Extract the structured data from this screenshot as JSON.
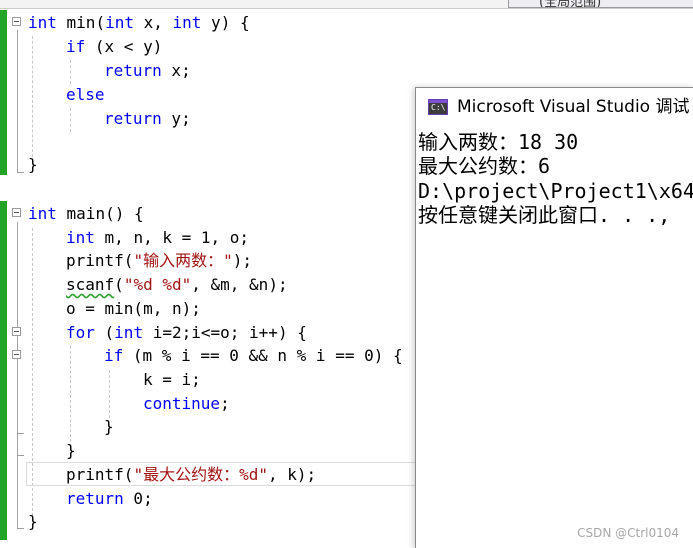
{
  "top_tab": {
    "label": "(全局范围)"
  },
  "editor": {
    "lines": [
      {
        "id": "l1",
        "tokens": [
          [
            "kw",
            "int"
          ],
          [
            "id",
            " min("
          ],
          [
            "kw",
            "int"
          ],
          [
            "id",
            " x, "
          ],
          [
            "kw",
            "int"
          ],
          [
            "id",
            " y) {"
          ]
        ]
      },
      {
        "id": "l2",
        "tokens": [
          [
            "kw",
            "if"
          ],
          [
            "id",
            " (x < y)"
          ]
        ]
      },
      {
        "id": "l3",
        "tokens": [
          [
            "kw",
            "return"
          ],
          [
            "id",
            " x;"
          ]
        ]
      },
      {
        "id": "l4",
        "tokens": [
          [
            "kw",
            "else"
          ]
        ]
      },
      {
        "id": "l5",
        "tokens": [
          [
            "kw",
            "return"
          ],
          [
            "id",
            " y;"
          ]
        ]
      },
      {
        "id": "l7",
        "tokens": [
          [
            "id",
            "}"
          ]
        ]
      },
      {
        "id": "l9",
        "tokens": [
          [
            "kw",
            "int"
          ],
          [
            "id",
            " main() {"
          ]
        ]
      },
      {
        "id": "l10",
        "tokens": [
          [
            "kw",
            "int"
          ],
          [
            "id",
            " m, n, k = 1, o;"
          ]
        ]
      },
      {
        "id": "l11",
        "tokens": [
          [
            "id",
            "printf("
          ],
          [
            "str",
            "\"输入两数：\""
          ],
          [
            "id",
            ");"
          ]
        ]
      },
      {
        "id": "l12",
        "tokens": [
          [
            "sq",
            "scanf"
          ],
          [
            "id",
            "("
          ],
          [
            "str",
            "\"%d %d\""
          ],
          [
            "id",
            ", &m, &n);"
          ]
        ]
      },
      {
        "id": "l13",
        "tokens": [
          [
            "id",
            "o = min(m, n);"
          ]
        ]
      },
      {
        "id": "l14",
        "tokens": [
          [
            "kw",
            "for"
          ],
          [
            "id",
            " ("
          ],
          [
            "kw",
            "int"
          ],
          [
            "id",
            " i=2;i<=o; i++) {"
          ]
        ]
      },
      {
        "id": "l15",
        "tokens": [
          [
            "kw",
            "if"
          ],
          [
            "id",
            " (m % i == 0 && n % i == 0) {"
          ]
        ]
      },
      {
        "id": "l16",
        "tokens": [
          [
            "id",
            "k = i;"
          ]
        ]
      },
      {
        "id": "l17",
        "tokens": [
          [
            "kw",
            "continue"
          ],
          [
            "id",
            ";"
          ]
        ]
      },
      {
        "id": "l18",
        "tokens": [
          [
            "id",
            "}"
          ]
        ]
      },
      {
        "id": "l19",
        "tokens": [
          [
            "id",
            "}"
          ]
        ]
      },
      {
        "id": "l20",
        "tokens": [
          [
            "id",
            "printf("
          ],
          [
            "str",
            "\"最大公约数：%d\""
          ],
          [
            "id",
            ", k);"
          ]
        ]
      },
      {
        "id": "l21",
        "tokens": [
          [
            "kw",
            "return"
          ],
          [
            "id",
            " 0;"
          ]
        ]
      },
      {
        "id": "l22",
        "tokens": [
          [
            "id",
            "}"
          ]
        ]
      }
    ]
  },
  "console": {
    "title": "Microsoft Visual Studio 调试",
    "icon_glyph": "C:\\",
    "lines": [
      "输入两数：18 30",
      "最大公约数：6",
      "D:\\project\\Project1\\x64",
      "按任意键关闭此窗口. . .,"
    ]
  },
  "watermark": "CSDN @Ctrl0104",
  "colors": {
    "keyword": "#0000ff",
    "string": "#a31515",
    "change_bar": "#22a526",
    "squiggle": "#2aa02a"
  }
}
